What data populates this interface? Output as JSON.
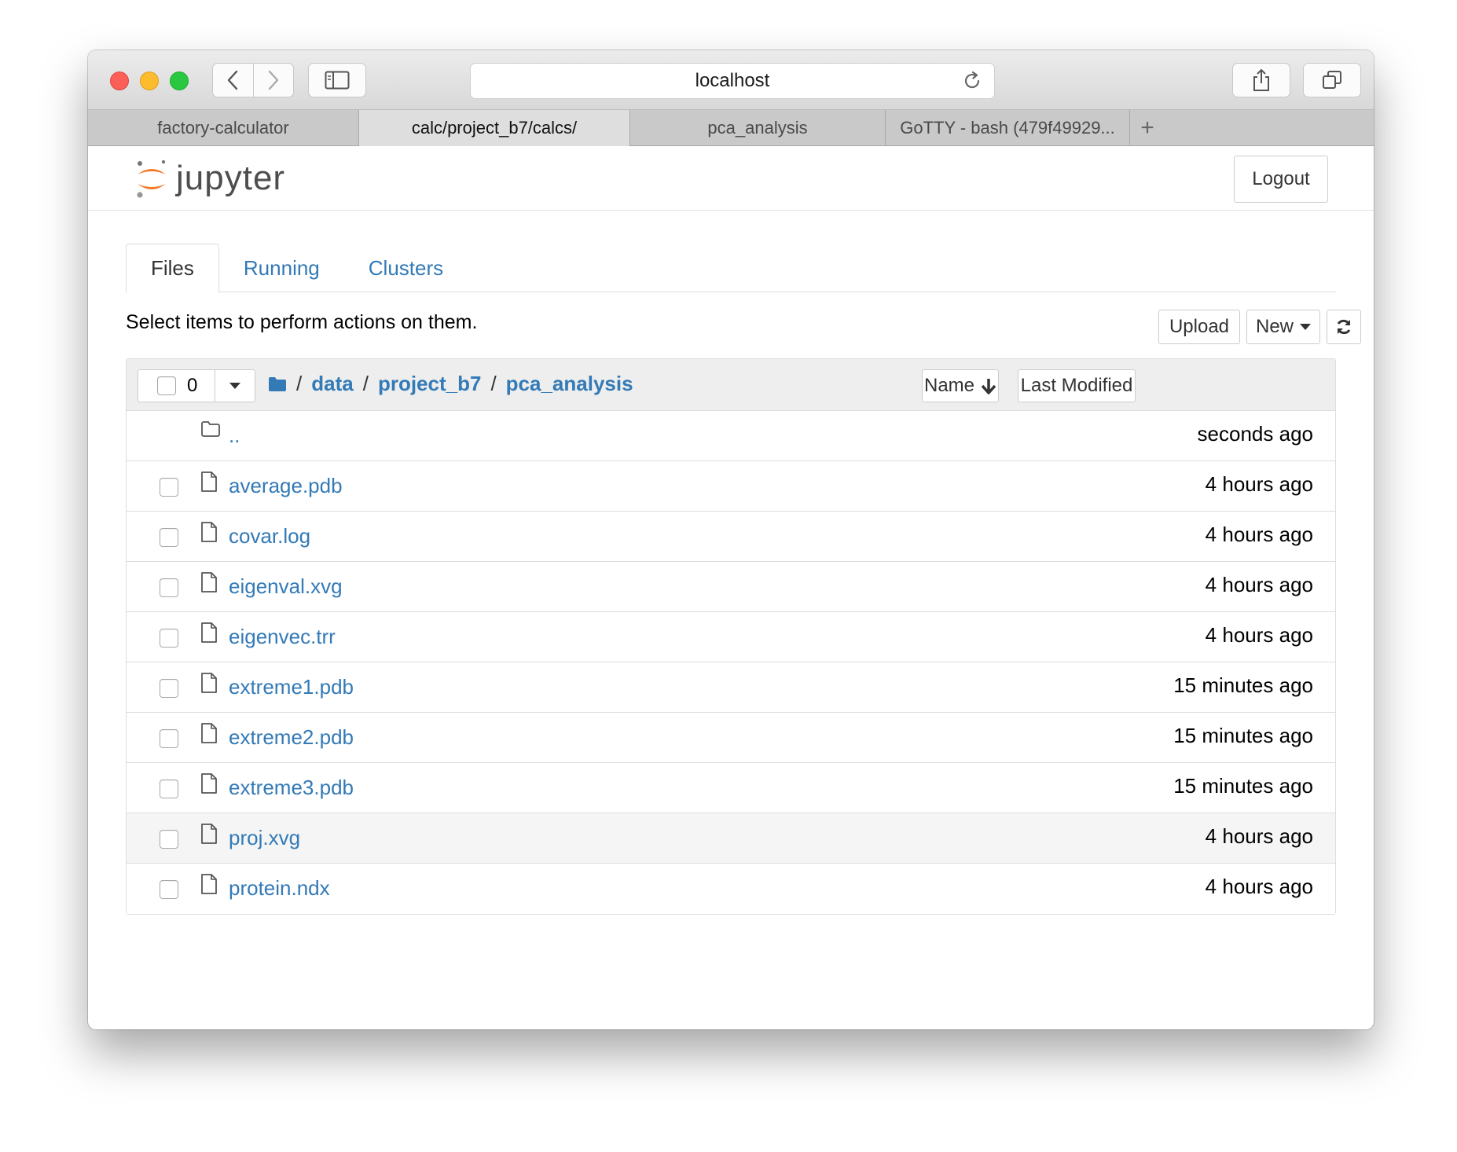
{
  "browser": {
    "url": "localhost",
    "tabs": [
      {
        "label": "factory-calculator",
        "active": false
      },
      {
        "label": "calc/project_b7/calcs/",
        "active": true
      },
      {
        "label": "pca_analysis",
        "active": false
      },
      {
        "label": "GoTTY - bash (479f49929...",
        "active": false
      }
    ],
    "new_tab_label": "+"
  },
  "header": {
    "logo_text": "jupyter",
    "logout_label": "Logout"
  },
  "nav_tabs": [
    {
      "label": "Files",
      "active": true
    },
    {
      "label": "Running",
      "active": false
    },
    {
      "label": "Clusters",
      "active": false
    }
  ],
  "toolbar": {
    "hint": "Select items to perform actions on them.",
    "upload_label": "Upload",
    "new_label": "New"
  },
  "list_header": {
    "selected_count": "0",
    "breadcrumb": [
      "data",
      "project_b7",
      "pca_analysis"
    ],
    "breadcrumb_sep": "/",
    "sort_name_label": "Name",
    "sort_modified_label": "Last Modified"
  },
  "rows": [
    {
      "name": "..",
      "modified": "seconds ago",
      "type": "folder"
    },
    {
      "name": "average.pdb",
      "modified": "4 hours ago",
      "type": "file"
    },
    {
      "name": "covar.log",
      "modified": "4 hours ago",
      "type": "file"
    },
    {
      "name": "eigenval.xvg",
      "modified": "4 hours ago",
      "type": "file"
    },
    {
      "name": "eigenvec.trr",
      "modified": "4 hours ago",
      "type": "file"
    },
    {
      "name": "extreme1.pdb",
      "modified": "15 minutes ago",
      "type": "file"
    },
    {
      "name": "extreme2.pdb",
      "modified": "15 minutes ago",
      "type": "file"
    },
    {
      "name": "extreme3.pdb",
      "modified": "15 minutes ago",
      "type": "file"
    },
    {
      "name": "proj.xvg",
      "modified": "4 hours ago",
      "type": "file"
    },
    {
      "name": "protein.ndx",
      "modified": "4 hours ago",
      "type": "file"
    }
  ],
  "colors": {
    "link": "#337ab7",
    "jupyter_orange": "#f37726"
  }
}
